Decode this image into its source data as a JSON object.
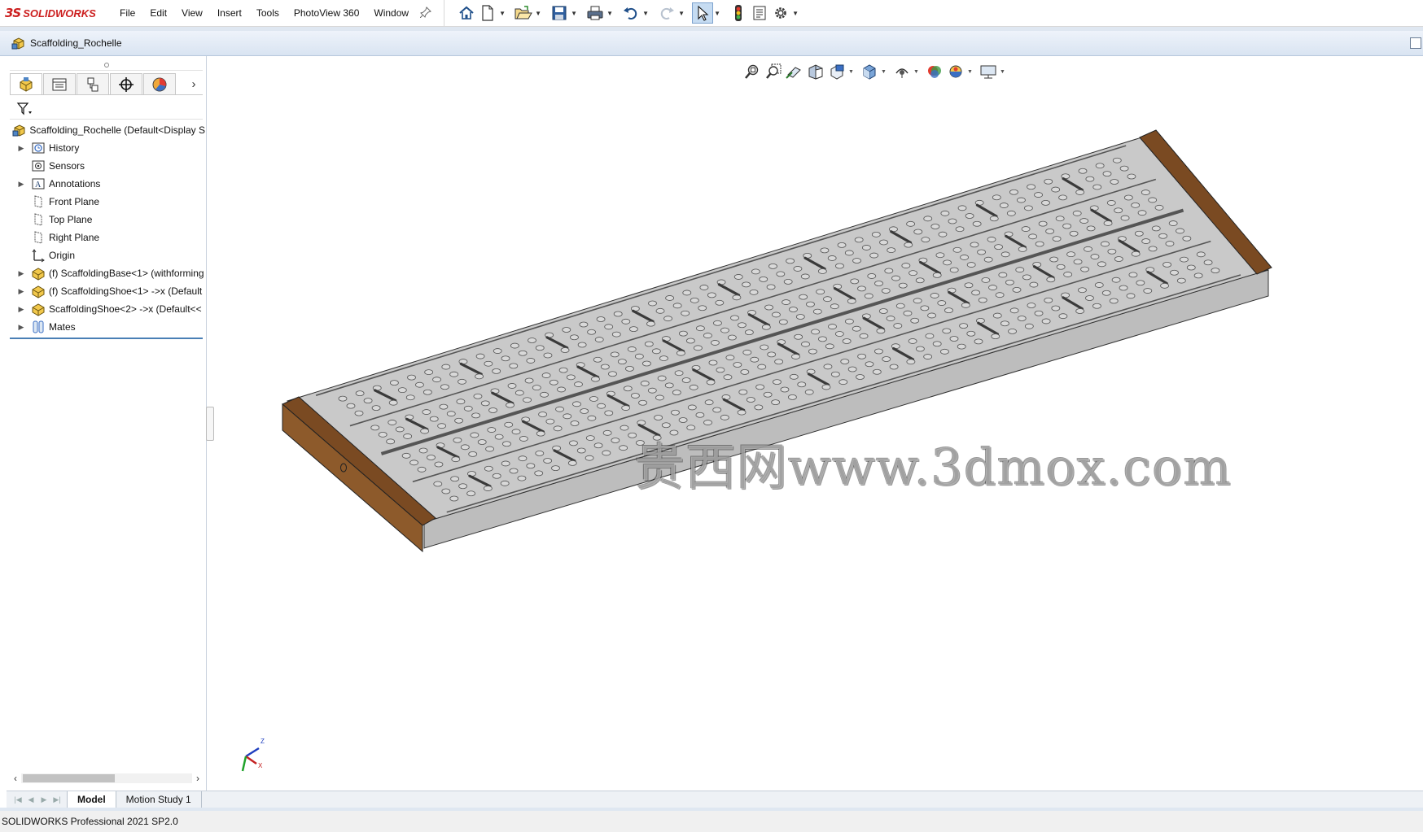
{
  "app": {
    "logo_ds": "3S",
    "logo_text": "SOLIDWORKS",
    "menu": [
      "File",
      "Edit",
      "View",
      "Insert",
      "Tools",
      "PhotoView 360",
      "Window"
    ]
  },
  "quick_access_icons": [
    "home-icon",
    "new-document-icon",
    "open-icon",
    "save-icon",
    "print-icon",
    "undo-icon",
    "redo-icon",
    "select-icon",
    "rebuild-icon",
    "file-properties-icon",
    "options-icon"
  ],
  "document": {
    "title": "Scaffolding_Rochelle"
  },
  "feature_manager": {
    "tabs": [
      "feature-manager-tab",
      "property-manager-tab",
      "configuration-manager-tab",
      "dimxpert-manager-tab",
      "display-manager-tab"
    ],
    "tree": [
      {
        "label": "Scaffolding_Rochelle  (Default<Display S",
        "icon": "assembly-icon",
        "expandable": false,
        "root": true
      },
      {
        "label": "History",
        "icon": "history-icon",
        "expandable": true
      },
      {
        "label": "Sensors",
        "icon": "sensors-icon",
        "expandable": false
      },
      {
        "label": "Annotations",
        "icon": "annotations-icon",
        "expandable": true
      },
      {
        "label": "Front Plane",
        "icon": "plane-icon",
        "expandable": false
      },
      {
        "label": "Top Plane",
        "icon": "plane-icon",
        "expandable": false
      },
      {
        "label": "Right Plane",
        "icon": "plane-icon",
        "expandable": false
      },
      {
        "label": "Origin",
        "icon": "origin-icon",
        "expandable": false
      },
      {
        "label": "(f) ScaffoldingBase<1> (withforming",
        "icon": "part-icon",
        "expandable": true
      },
      {
        "label": "(f) ScaffoldingShoe<1> ->x (Default",
        "icon": "part-icon",
        "expandable": true
      },
      {
        "label": "ScaffoldingShoe<2> ->x (Default<<",
        "icon": "part-icon",
        "expandable": true
      },
      {
        "label": "Mates",
        "icon": "mates-icon",
        "expandable": true
      }
    ]
  },
  "bottom_tabs": [
    "Model",
    "Motion Study 1"
  ],
  "status_bar": "SOLIDWORKS Professional 2021 SP2.0",
  "watermark": "贵西网www.3dmox.com",
  "heads_up_toolbar": [
    "zoom-to-fit-icon",
    "zoom-to-area-icon",
    "previous-view-icon",
    "section-view-icon",
    "dynamic-annotation-icon",
    "view-orientation-icon",
    "display-style-icon",
    "hide-show-icon",
    "edit-appearance-icon",
    "apply-scene-icon",
    "view-settings-icon"
  ],
  "triad": {
    "z": "Z",
    "x": "X"
  },
  "colors": {
    "brand_red": "#cc1f1f",
    "tree_accent": "#4a7fb5",
    "plank_steel": "#c9c9c9",
    "shoe_wood": "#7a4a22"
  }
}
